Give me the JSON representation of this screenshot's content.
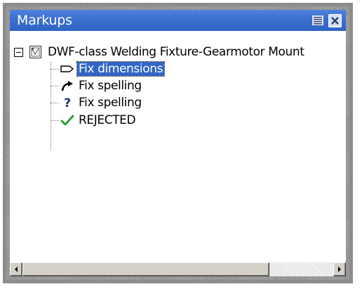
{
  "window": {
    "title": "Markups"
  },
  "tree": {
    "root": {
      "label": "DWF-class Welding Fixture-Gearmotor Mount",
      "expanded": true,
      "icon": "document-icon"
    },
    "items": [
      {
        "label": "Fix dimensions",
        "icon": "arrow-outline-icon",
        "selected": true
      },
      {
        "label": "Fix spelling",
        "icon": "curved-arrow-icon",
        "selected": false
      },
      {
        "label": "Fix spelling",
        "icon": "question-icon",
        "selected": false
      },
      {
        "label": "REJECTED",
        "icon": "checkmark-icon",
        "selected": false
      }
    ]
  },
  "colors": {
    "titlebar": "#3b6fcf",
    "selection": "#3166c6",
    "checkmark": "#2e9b3a"
  }
}
